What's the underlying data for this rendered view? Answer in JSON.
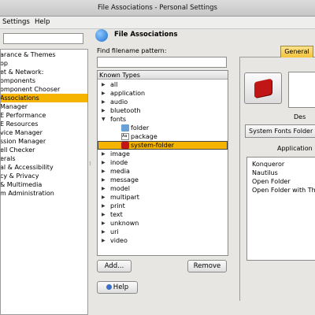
{
  "window": {
    "title": "File Associations - Personal Settings"
  },
  "menubar": {
    "settings": "Settings",
    "help": "Help"
  },
  "sidebar": {
    "search_value": "",
    "items": [
      {
        "label": "arance & Themes"
      },
      {
        "label": "op"
      },
      {
        "label": "et & Network:"
      },
      {
        "label": "omponents"
      },
      {
        "label": "omponent Chooser"
      },
      {
        "label": "Associations",
        "selected": true
      },
      {
        "label": "Manager"
      },
      {
        "label": "E Performance"
      },
      {
        "label": "E Resources"
      },
      {
        "label": "vice Manager"
      },
      {
        "label": "ssion Manager"
      },
      {
        "label": "ell Checker"
      },
      {
        "label": "erals"
      },
      {
        "label": "al & Accessibility"
      },
      {
        "label": "cy & Privacy"
      },
      {
        "label": "& Multimedia"
      },
      {
        "label": "m Administration"
      }
    ]
  },
  "module": {
    "title": "File Associations",
    "icon": "globe-icon"
  },
  "pattern": {
    "label": "Find filename pattern:",
    "value": ""
  },
  "types": {
    "header": "Known Types",
    "items": [
      {
        "label": "all"
      },
      {
        "label": "application"
      },
      {
        "label": "audio"
      },
      {
        "label": "bluetooth"
      },
      {
        "label": "fonts",
        "expanded": true
      },
      {
        "label": "image"
      },
      {
        "label": "inode"
      },
      {
        "label": "media"
      },
      {
        "label": "message"
      },
      {
        "label": "model"
      },
      {
        "label": "multipart"
      },
      {
        "label": "print"
      },
      {
        "label": "text"
      },
      {
        "label": "unknown"
      },
      {
        "label": "uri"
      },
      {
        "label": "video"
      }
    ],
    "fonts_children": [
      {
        "label": "folder",
        "icon": "folder-icon"
      },
      {
        "label": "package",
        "icon": "package-icon"
      },
      {
        "label": "system-folder",
        "icon": "red-book-icon",
        "selected": true
      }
    ]
  },
  "buttons": {
    "add": "Add...",
    "remove": "Remove",
    "help": "Help"
  },
  "right_panel": {
    "tab_general": "General",
    "description_label": "Des",
    "description_value": "System Fonts Folder",
    "app_pref_label": "Application P",
    "applications": [
      "Konqueror",
      "Nautilus",
      "Open Folder",
      "Open Folder with Th"
    ]
  },
  "colors": {
    "selection": "#f5b400",
    "tab_active": "#f2c33c"
  }
}
